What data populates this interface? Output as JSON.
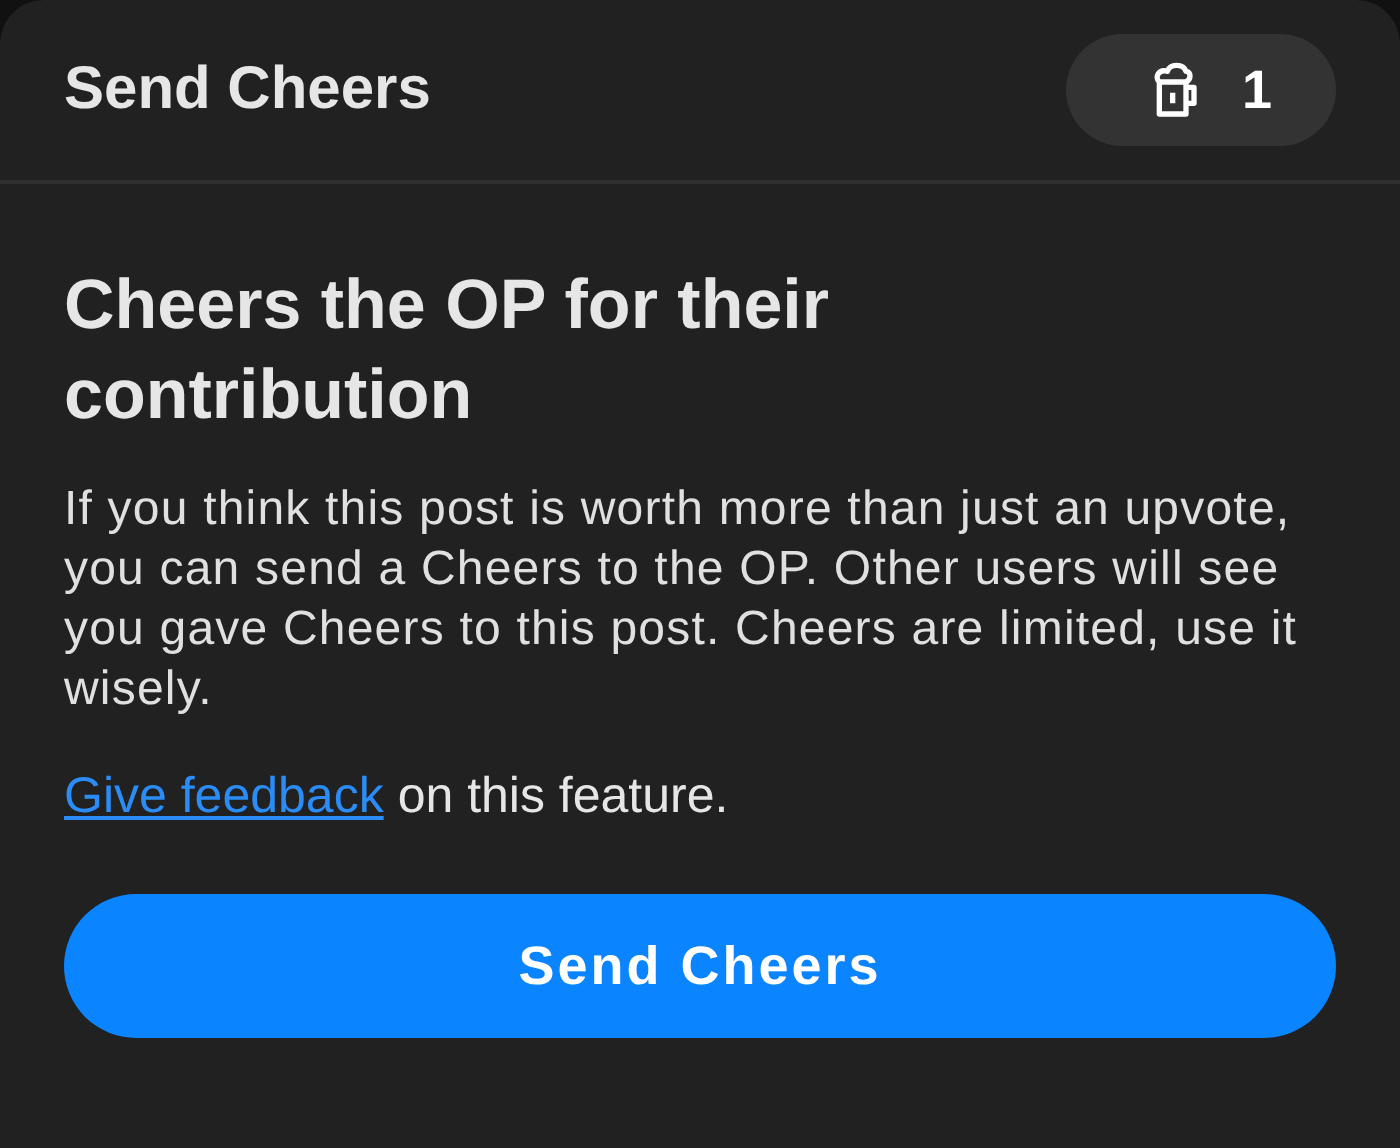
{
  "header": {
    "title": "Send Cheers",
    "cheers_count": "1"
  },
  "heading": "Cheers the OP for their contribution",
  "description": "If you think this post is worth more than just an upvote, you can send a Cheers to the OP. Other users will see you gave Cheers to this post. Cheers are limited, use it wisely.",
  "feedback": {
    "link": "Give feedback",
    "rest": "on this feature."
  },
  "button": "Send Cheers"
}
